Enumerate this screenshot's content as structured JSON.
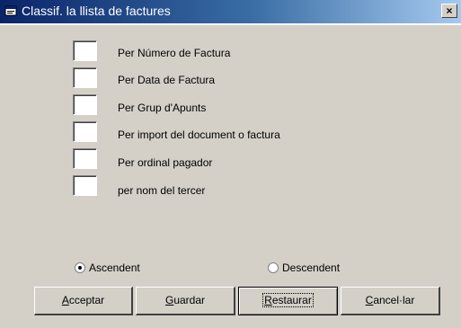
{
  "window": {
    "title": "Classif. la llista de factures",
    "close_label": "×"
  },
  "options": [
    {
      "label": "Per Número de Factura"
    },
    {
      "label": "Per Data de Factura"
    },
    {
      "label": "Per Grup d'Apunts"
    },
    {
      "label": "Per import del document o factura"
    },
    {
      "label": "Per ordinal pagador"
    },
    {
      "label": "per nom del tercer"
    }
  ],
  "order": {
    "ascendent_label": "Ascendent",
    "descendent_label": "Descendent",
    "selected": "Ascendent"
  },
  "buttons": {
    "accept": {
      "hotkey": "A",
      "rest": "cceptar"
    },
    "save": {
      "hotkey": "G",
      "rest": "uardar"
    },
    "restore": {
      "hotkey": "R",
      "rest": "estaurar"
    },
    "cancel": {
      "hotkey": "C",
      "rest": "ancel·lar"
    }
  },
  "colors": {
    "titlebar_start": "#0a246a",
    "titlebar_end": "#a6caf0",
    "face": "#d4d0c8"
  }
}
